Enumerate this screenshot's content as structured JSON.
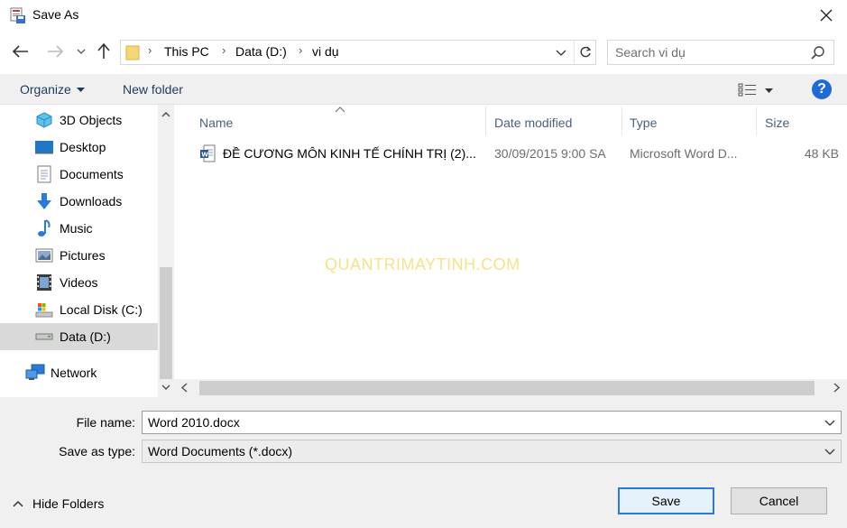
{
  "window": {
    "title": "Save As"
  },
  "breadcrumb": {
    "items": [
      "This PC",
      "Data (D:)",
      "vi dụ"
    ]
  },
  "search": {
    "placeholder": "Search vi dụ"
  },
  "toolbar": {
    "organize_label": "Organize",
    "new_folder_label": "New folder",
    "help_label": "?"
  },
  "nav": {
    "items": [
      {
        "label": "3D Objects",
        "icon": "3d-objects-icon"
      },
      {
        "label": "Desktop",
        "icon": "desktop-icon"
      },
      {
        "label": "Documents",
        "icon": "documents-icon"
      },
      {
        "label": "Downloads",
        "icon": "downloads-icon"
      },
      {
        "label": "Music",
        "icon": "music-icon"
      },
      {
        "label": "Pictures",
        "icon": "pictures-icon"
      },
      {
        "label": "Videos",
        "icon": "videos-icon"
      },
      {
        "label": "Local Disk (C:)",
        "icon": "local-disk-icon"
      },
      {
        "label": "Data (D:)",
        "icon": "drive-icon",
        "selected": true
      },
      {
        "label": "Network",
        "icon": "network-icon"
      }
    ]
  },
  "files": {
    "columns": [
      "Name",
      "Date modified",
      "Type",
      "Size"
    ],
    "rows": [
      {
        "name": "ĐỀ CƯƠNG MÔN KINH TẾ CHÍNH TRỊ (2)...",
        "date": "30/09/2015 9:00 SA",
        "type": "Microsoft Word D...",
        "size": "48 KB"
      }
    ]
  },
  "watermark": "QUANTRIMAYTINH.COM",
  "form": {
    "file_name_label": "File name:",
    "file_name_value": "Word 2010.docx",
    "save_type_label": "Save as type:",
    "save_type_value": "Word Documents (*.docx)"
  },
  "footer": {
    "hide_folders_label": "Hide Folders",
    "save_label": "Save",
    "cancel_label": "Cancel"
  },
  "colors": {
    "accent": "#2c7ad6",
    "help": "#1e6bd6",
    "selected_nav": "#d9d9d9"
  }
}
